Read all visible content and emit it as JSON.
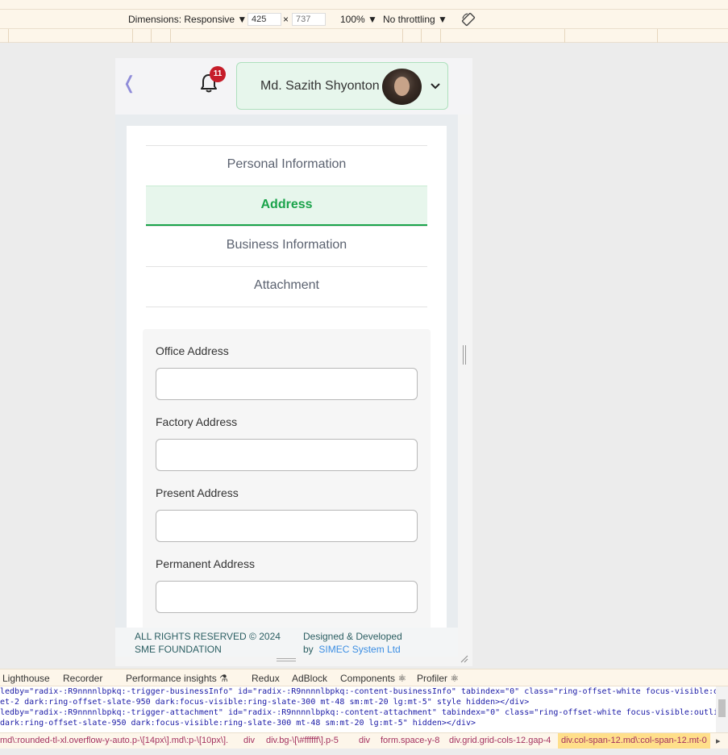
{
  "devtools": {
    "dimensions_label": "Dimensions: Responsive ▼",
    "width_value": "425",
    "height_placeholder": "737",
    "times": "×",
    "zoom": "100% ▼",
    "throttling": "No throttling ▼",
    "rotate_icon": "rotate-icon",
    "tabs": [
      "Lighthouse",
      "Recorder",
      "Performance insights ⚗",
      "Redux",
      "AdBlock",
      "Components ⚛",
      "Profiler ⚛"
    ],
    "code_lines": [
      "ledby=\"radix-:R9nnnnlbpkq:-trigger-businessInfo\" id=\"radix-:R9nnnnlbpkq:-content-businessInfo\" tabindex=\"0\" class=\"ring-offset-white focus-visible:out",
      "et-2 dark:ring-offset-slate-950 dark:focus-visible:ring-slate-300 mt-48 sm:mt-20 lg:mt-5\" style hidden></div>",
      "ledby=\"radix-:R9nnnnlbpkq:-trigger-attachment\" id=\"radix-:R9nnnnlbpkq:-content-attachment\" tabindex=\"0\" class=\"ring-offset-white focus-visible:outline",
      " dark:ring-offset-slate-950 dark:focus-visible:ring-slate-300 mt-48 sm:mt-20 lg:mt-5\" hidden></div>"
    ],
    "breadcrumbs": [
      "md\\:rounded-tl-xl.overflow-y-auto.p-\\[14px\\].md\\:p-\\[10px\\].",
      "div",
      "div.bg-\\[\\#ffffff\\].p-5",
      "div",
      "form.space-y-8",
      "div.grid.grid-cols-12.gap-4",
      "div.col-span-12.md\\:col-span-12.mt-0"
    ]
  },
  "header": {
    "back_icon": "chevron-left-icon",
    "notification_count": "11",
    "user_name": "Md. Sazith Shyonton",
    "dropdown_icon": "chevron-down-icon"
  },
  "tabs": [
    {
      "label": "Personal Information",
      "active": false
    },
    {
      "label": "Address",
      "active": true
    },
    {
      "label": "Business Information",
      "active": false
    },
    {
      "label": "Attachment",
      "active": false
    }
  ],
  "form": {
    "fields": [
      {
        "label": "Office Address",
        "value": ""
      },
      {
        "label": "Factory Address",
        "value": ""
      },
      {
        "label": "Present Address",
        "value": ""
      },
      {
        "label": "Permanent Address",
        "value": ""
      }
    ]
  },
  "footer": {
    "rights_line1": "ALL RIGHTS RESERVED © 2024",
    "rights_line2": "SME FOUNDATION",
    "designed_line1": "Designed & Developed",
    "designed_by": "by",
    "company": "SIMEC System Ltd"
  },
  "colors": {
    "accent": "#1aa34a",
    "badge": "#c61d2a",
    "link": "#3c8ee3"
  }
}
